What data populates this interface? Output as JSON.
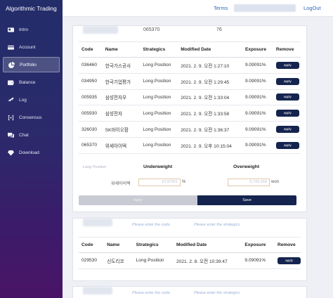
{
  "app": {
    "title": "Algorithmic Trading"
  },
  "nav": [
    {
      "label": "Intro",
      "icon": "id-card-icon"
    },
    {
      "label": "Account",
      "icon": "credit-card-icon"
    },
    {
      "label": "Portfolio",
      "icon": "pie-chart-icon",
      "active": true
    },
    {
      "label": "Balance",
      "icon": "wallet-icon"
    },
    {
      "label": "Log",
      "icon": "link-icon"
    },
    {
      "label": "Consensus",
      "icon": "brackets-icon"
    },
    {
      "label": "Chat",
      "icon": "chat-icon"
    },
    {
      "label": "Download",
      "icon": "gem-icon"
    }
  ],
  "topbar": {
    "terms": "Terms",
    "logout": "LogOut"
  },
  "card1": {
    "code": "065370",
    "count": "76",
    "columns": [
      "Code",
      "Name",
      "Strategics",
      "Modified Date",
      "Exposure",
      "Remove"
    ],
    "rows": [
      {
        "code": "036460",
        "name": "한국가스공사",
        "strategy": "Long Position",
        "date": "2021. 2. 9. 오전 1:27:10",
        "exposure": "9.09091%",
        "action": "apply"
      },
      {
        "code": "034950",
        "name": "한국기업평가",
        "strategy": "Long Position",
        "date": "2021. 2. 9. 오전 1:29:45",
        "exposure": "9.09091%",
        "action": "apply"
      },
      {
        "code": "005935",
        "name": "삼성전자우",
        "strategy": "Long Position",
        "date": "2021. 2. 9. 오전 1:33:04",
        "exposure": "9.09091%",
        "action": "apply"
      },
      {
        "code": "005930",
        "name": "삼성전자",
        "strategy": "Long Position",
        "date": "2021. 2. 9. 오전 1:33:58",
        "exposure": "9.09091%",
        "action": "apply"
      },
      {
        "code": "326030",
        "name": "SK바이오팜",
        "strategy": "Long Position",
        "date": "2021. 2. 9. 오전 1:36:37",
        "exposure": "9.09091%",
        "action": "apply"
      },
      {
        "code": "065370",
        "name": "위세아이텍",
        "strategy": "Long Position",
        "date": "2021. 2. 9. 오후 10:15:04",
        "exposure": "9.09091%",
        "action": "apply"
      }
    ],
    "long_position_label": "Long Position",
    "underweight_label": "Underweight",
    "overweight_label": "Overweight",
    "stock_label": "위세아이텍",
    "underweight_value": "10.97351",
    "underweight_unit": "%",
    "overweight_value": "5,720,160",
    "overweight_unit": "won",
    "apply_button": "Apply",
    "save_button": "Save"
  },
  "card2": {
    "code_placeholder": "Please enter the code.",
    "strategy_placeholder": "Please enter the strategics.",
    "columns": [
      "Code",
      "Name",
      "Strategics",
      "Modified Date",
      "Exposure",
      "Remove"
    ],
    "rows": [
      {
        "code": "029530",
        "name": "신도리코",
        "strategy": "Long Position",
        "date": "2021. 2. 8. 오전 10:39:47",
        "exposure": "9.09091%",
        "action": "apply"
      }
    ]
  },
  "card3": {
    "code_placeholder": "Please enter the code.",
    "strategy_placeholder": "Please enter the strategics."
  }
}
